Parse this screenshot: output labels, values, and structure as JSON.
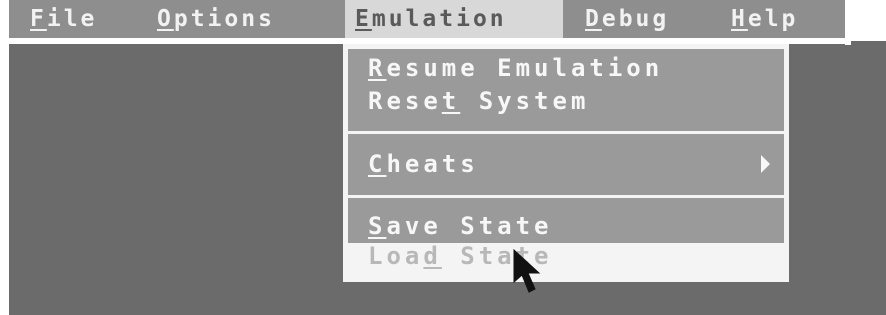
{
  "menubar": {
    "items": [
      {
        "hotkey": "F",
        "rest": "ile"
      },
      {
        "hotkey": "O",
        "rest": "ptions"
      },
      {
        "hotkey": "E",
        "rest": "mulation"
      },
      {
        "hotkey": "D",
        "rest": "ebug"
      },
      {
        "hotkey": "H",
        "rest": "elp"
      }
    ],
    "active": "Emulation"
  },
  "emulation_menu": {
    "resume": {
      "hotkey": "R",
      "rest": "esume Emulation"
    },
    "reset": {
      "before": "Rese",
      "hotkey": "t",
      "rest": " System"
    },
    "cheats": {
      "hotkey": "C",
      "rest": "heats"
    },
    "save_state": {
      "hotkey": "S",
      "rest": "ave State"
    },
    "load_state": {
      "before": "Loa",
      "hotkey": "d",
      "rest": " State",
      "disabled": true
    }
  },
  "icons": {
    "submenu_arrow": "triangle-right-icon",
    "cursor": "mouse-pointer-icon"
  },
  "colors": {
    "desktop": "#6b6b6b",
    "menubar": "#8e8e8e",
    "active_menu": "#d8d8d8",
    "dropdown": "#9a9a9a",
    "frame": "#f4f4f4"
  }
}
